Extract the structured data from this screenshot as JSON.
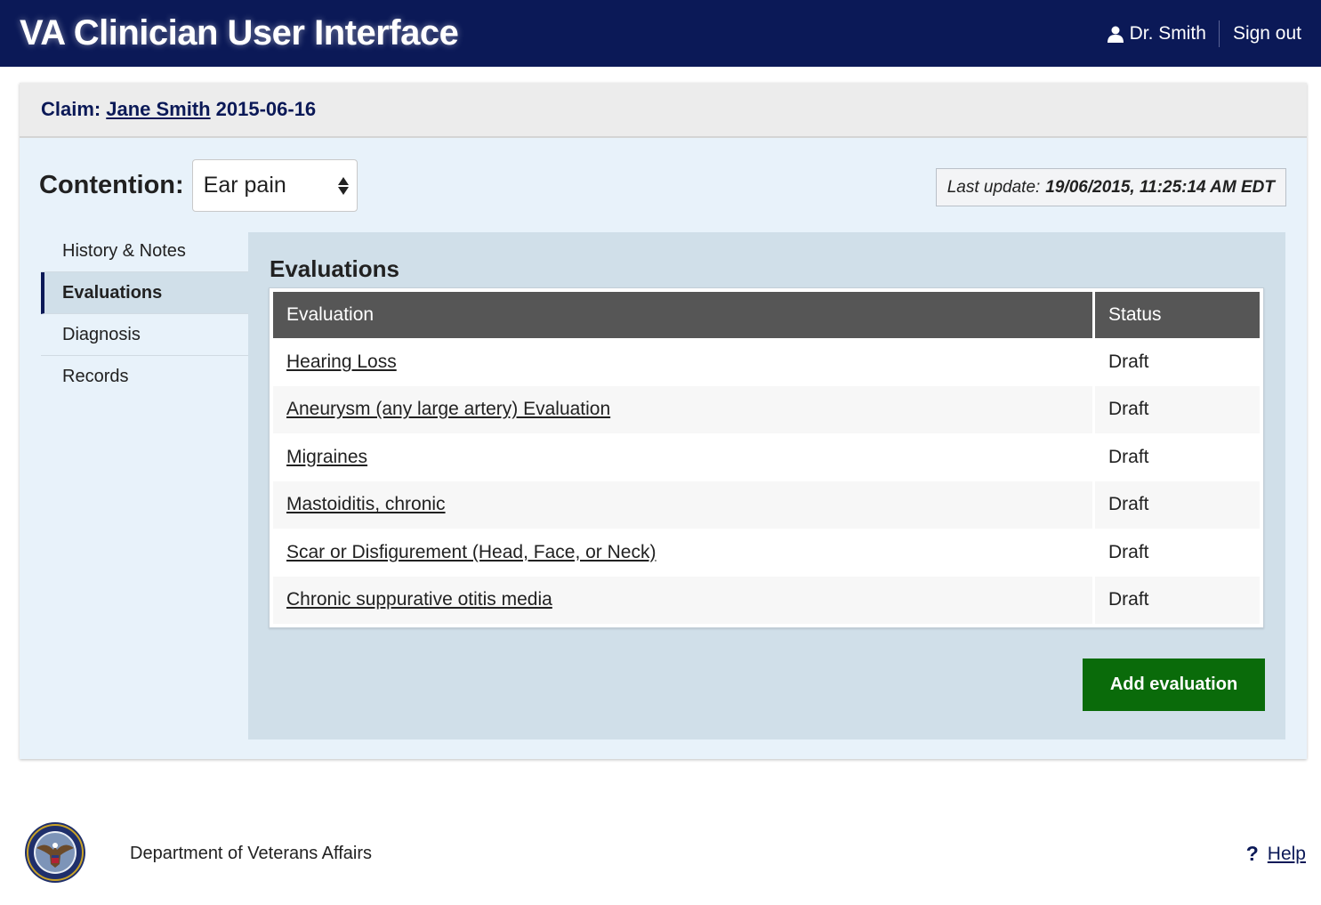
{
  "header": {
    "title": "VA Clinician User Interface",
    "user_name": "Dr. Smith",
    "sign_out_label": "Sign out"
  },
  "claim": {
    "prefix": "Claim:",
    "patient_name": "Jane Smith",
    "date": "2015-06-16"
  },
  "contention": {
    "label": "Contention:",
    "selected": "Ear pain"
  },
  "last_update": {
    "label": "Last update:",
    "value": "19/06/2015, 11:25:14 AM EDT"
  },
  "side_nav": {
    "items": [
      {
        "label": "History & Notes",
        "active": false
      },
      {
        "label": "Evaluations",
        "active": true
      },
      {
        "label": "Diagnosis",
        "active": false
      },
      {
        "label": "Records",
        "active": false
      }
    ]
  },
  "evaluations": {
    "title": "Evaluations",
    "columns": [
      "Evaluation",
      "Status"
    ],
    "rows": [
      {
        "name": "Hearing Loss",
        "status": "Draft"
      },
      {
        "name": "Aneurysm (any large artery) Evaluation",
        "status": "Draft"
      },
      {
        "name": "Migraines",
        "status": "Draft"
      },
      {
        "name": "Mastoiditis, chronic",
        "status": "Draft"
      },
      {
        "name": "Scar or Disfigurement (Head, Face, or Neck)",
        "status": "Draft"
      },
      {
        "name": "Chronic suppurative otitis media",
        "status": "Draft"
      }
    ],
    "add_button_label": "Add evaluation"
  },
  "footer": {
    "department": "Department of Veterans Affairs",
    "help_icon": "?",
    "help_label": "Help"
  },
  "colors": {
    "header_bg": "#0b1957",
    "add_button_bg": "#0a6b0a",
    "table_header_bg": "#565656",
    "panel_bg": "#d0dfe9"
  }
}
